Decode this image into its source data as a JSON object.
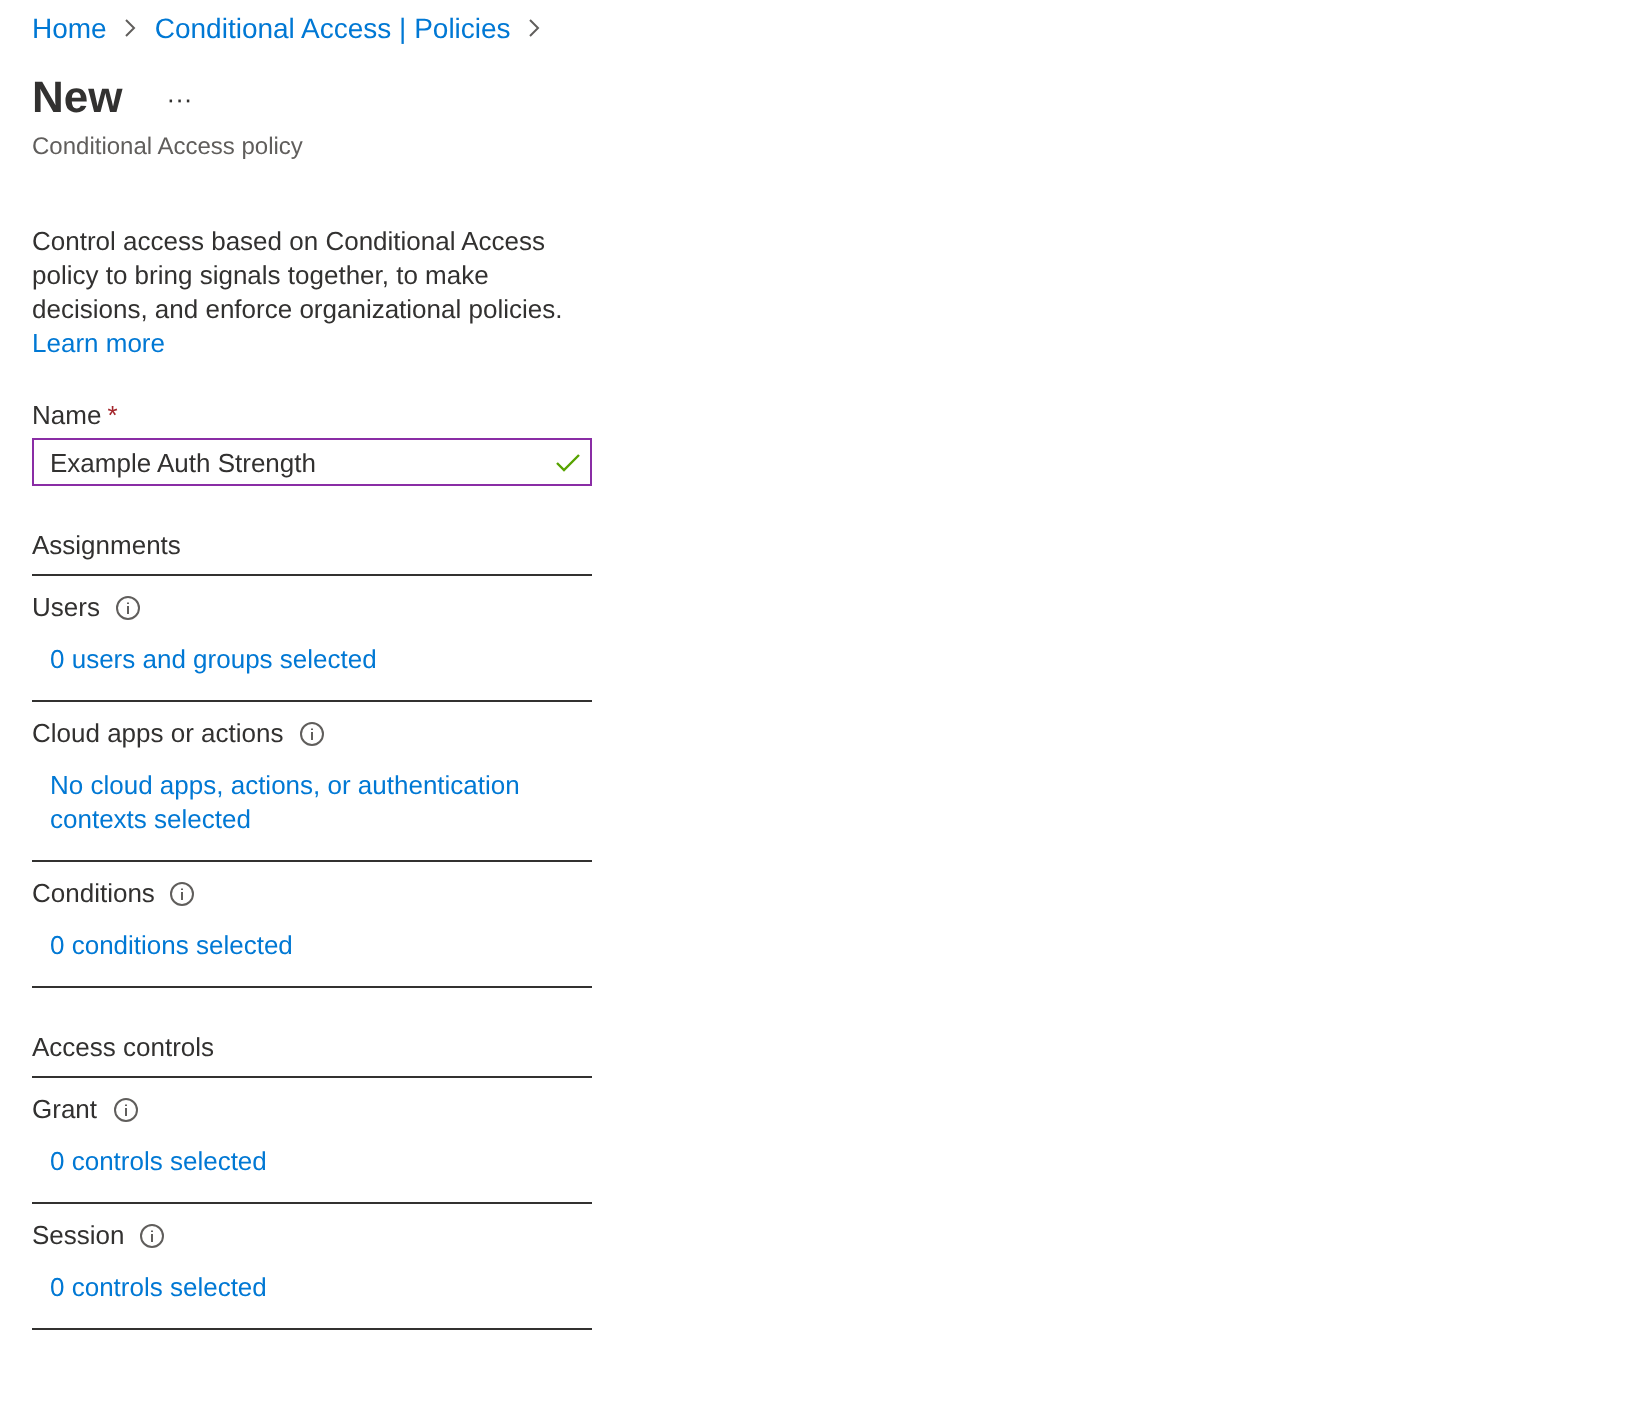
{
  "breadcrumb": [
    {
      "label": "Home"
    },
    {
      "label": "Conditional Access | Policies"
    }
  ],
  "title": "New",
  "more": "···",
  "subtitle": "Conditional Access policy",
  "description": "Control access based on Conditional Access policy to bring signals together, to make decisions, and enforce organizational policies.",
  "learn_more": "Learn more",
  "name_field": {
    "label": "Name",
    "required_mark": "*",
    "value": "Example Auth Strength",
    "valid": true
  },
  "sections": [
    {
      "title": "Assignments",
      "items": [
        {
          "label": "Users",
          "link": "0 users and groups selected"
        },
        {
          "label": "Cloud apps or actions",
          "link": "No cloud apps, actions, or authentication contexts selected"
        },
        {
          "label": "Conditions",
          "link": "0 conditions selected"
        }
      ]
    },
    {
      "title": "Access controls",
      "items": [
        {
          "label": "Grant",
          "link": "0 controls selected"
        },
        {
          "label": "Session",
          "link": "0 controls selected"
        }
      ]
    }
  ]
}
